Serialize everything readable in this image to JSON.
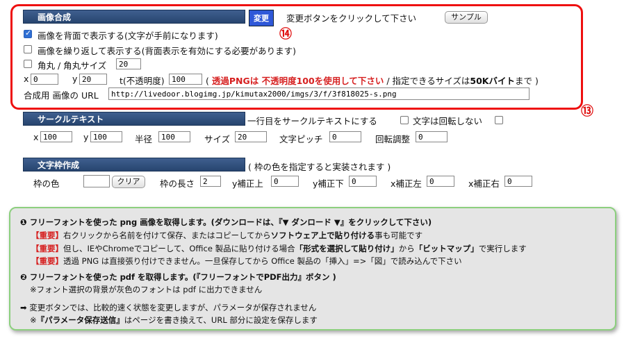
{
  "s1": {
    "title": "画像合成",
    "change_button": "変更",
    "click_hint": "変更ボタンをクリックして下さい",
    "sample_button": "サンプル",
    "marker_14": "⑭",
    "marker_13": "⑬",
    "opt_back": "画像を背面で表示する(文字が手前になります)",
    "opt_repeat": "画像を繰り返して表示する(背面表示を有効にする必要があります)",
    "opt_round": "角丸 / 角丸サイズ",
    "round_size": "20",
    "x_label": "x",
    "x_value": "0",
    "y_label": "y",
    "y_value": "20",
    "t_label": "t(不透明度)",
    "t_value": "100",
    "paren_open": "(",
    "png_warning": "透過PNGは 不透明度100を使用して下さい",
    "size_note": "/ 指定できるサイズは",
    "size_bold": "50Kバイト",
    "size_tail": "まで )",
    "url_label": "合成用 画像の URL",
    "url_value": "http://livedoor.blogimg.jp/kimutax2000/imgs/3/f/3f818025-s.png"
  },
  "s2": {
    "title": "サークルテキスト",
    "first_line": "一行目をサークルテキストにする",
    "no_rotate": "文字は回転しない",
    "x_label": "x",
    "x_value": "100",
    "y_label": "y",
    "y_value": "100",
    "r_label": "半径",
    "r_value": "100",
    "size_label": "サイズ",
    "size_value": "20",
    "pitch_label": "文字ピッチ",
    "pitch_value": "0",
    "rot_label": "回転調整",
    "rot_value": "0"
  },
  "s3": {
    "title": "文字枠作成",
    "note": "( 枠の色を指定すると実装されます )",
    "color_label": "枠の色",
    "color_value": "",
    "clear_button": "クリア",
    "len_label": "枠の長さ",
    "len_value": "2",
    "yu_label": "y補正上",
    "yu_value": "0",
    "yd_label": "y補正下",
    "yd_value": "0",
    "xl_label": "x補正左",
    "xl_value": "0",
    "xr_label": "x補正右",
    "xr_value": "0"
  },
  "info": {
    "l1_num": "❶",
    "l1": "フリーフォントを使った png 画像を取得します。(ダウンロードは、『▼ ダンロード ▼』をクリックして下さい)",
    "tag": "【重要】",
    "l2a": "右クリックから名前を付けて保存、またはコピーしてから",
    "l2b": "ソフトウェア上で貼り付ける",
    "l2c": "事も可能です",
    "l3a": "但し、IEやChromeでコピーして、Office 製品に貼り付ける場合",
    "l3b": "「形式を選択して貼り付け」",
    "l3c": "から",
    "l3d": "「ビットマップ」",
    "l3e": "で実行します",
    "l4": "透過 PNG は直接張り付けできません。一旦保存してから Office 製品の「挿入」=>「図」で読み込んで下さい",
    "l5_num": "❷",
    "l5": "フリーフォントを使った pdf を取得します。(『フリーフォントでPDF出力』ボタン )",
    "l6": "※フォント選択の背景が灰色のフォントは pdf に出力できません",
    "l7": "➡ 変更ボタンでは、比較的速く状態を変更しますが、パラメータが保存されません",
    "l8a": "※",
    "l8b": "『パラメータ保存送信』",
    "l8c": "はページを書き換えて、URL 部分に設定を保存します"
  }
}
